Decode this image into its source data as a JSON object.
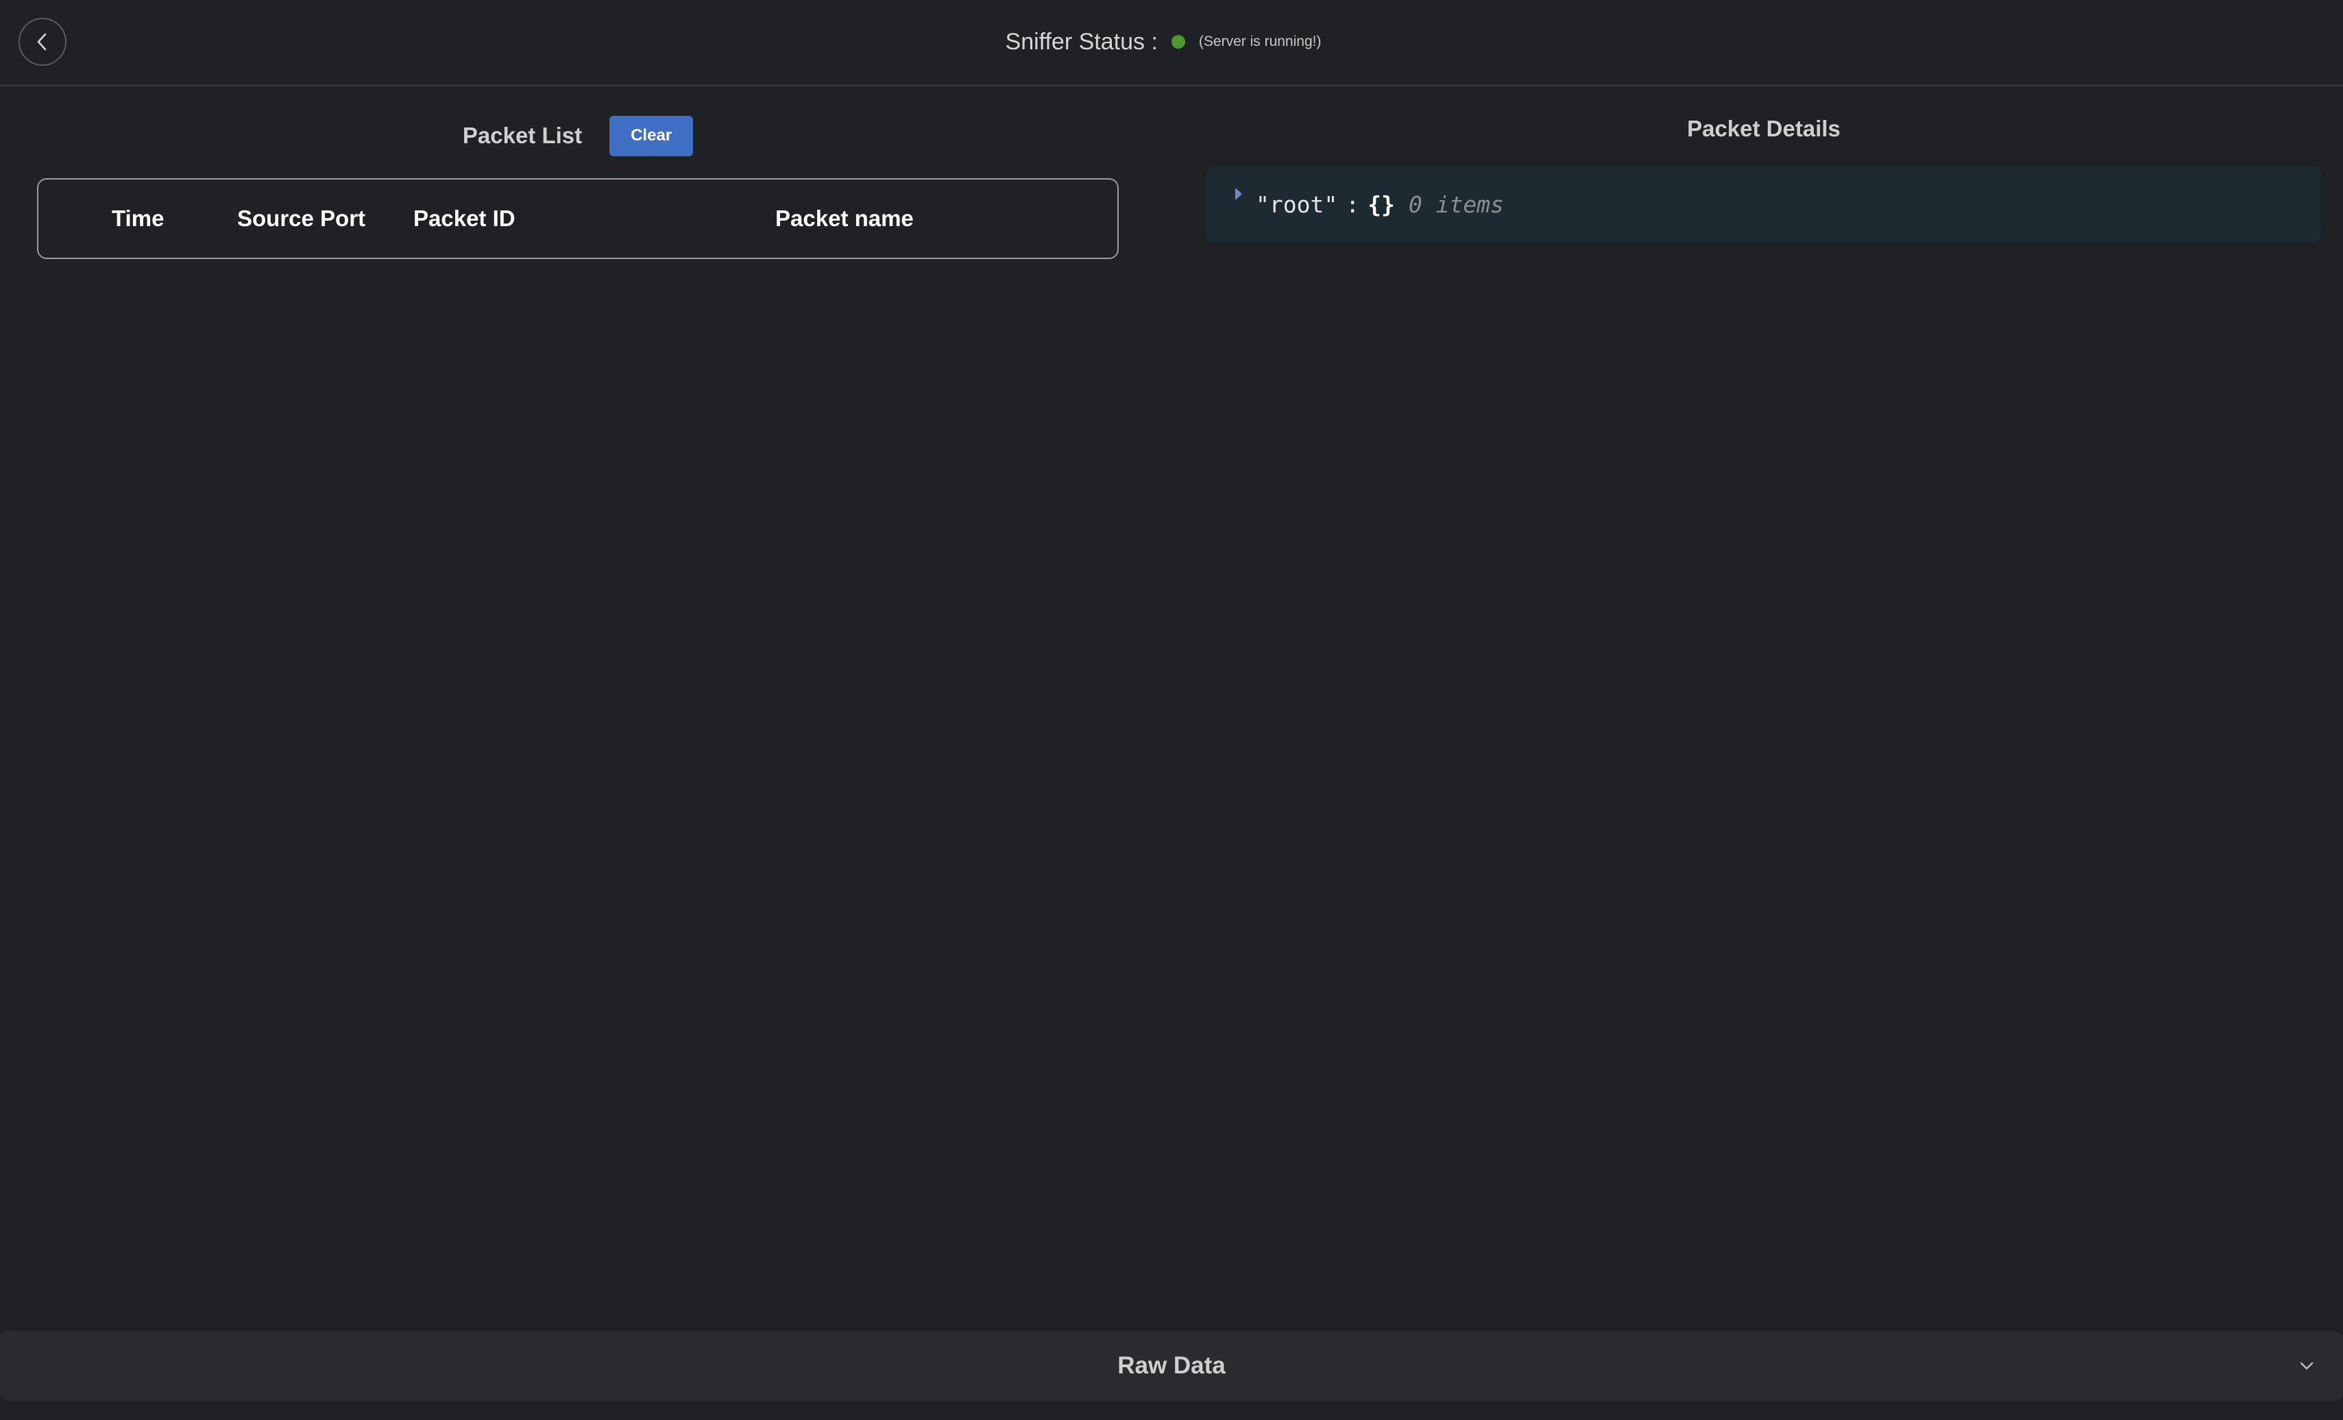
{
  "header": {
    "back_icon": "chevron-left-icon",
    "status_label": "Sniffer Status :",
    "status_color": "#4b9a2e",
    "status_text": "(Server is running!)"
  },
  "packet_list": {
    "title": "Packet List",
    "clear_label": "Clear",
    "columns": [
      "Time",
      "Source Port",
      "Packet ID",
      "Packet name"
    ],
    "rows": []
  },
  "packet_details": {
    "title": "Packet Details",
    "root_key": "\"root\"",
    "colon": ":",
    "braces": "{}",
    "item_count": "0 items"
  },
  "raw_data": {
    "label": "Raw Data",
    "toggle_icon": "chevron-down-icon"
  },
  "colors": {
    "background": "#202124",
    "accent": "#3f6fc4",
    "json_bg": "#1e2a32"
  }
}
